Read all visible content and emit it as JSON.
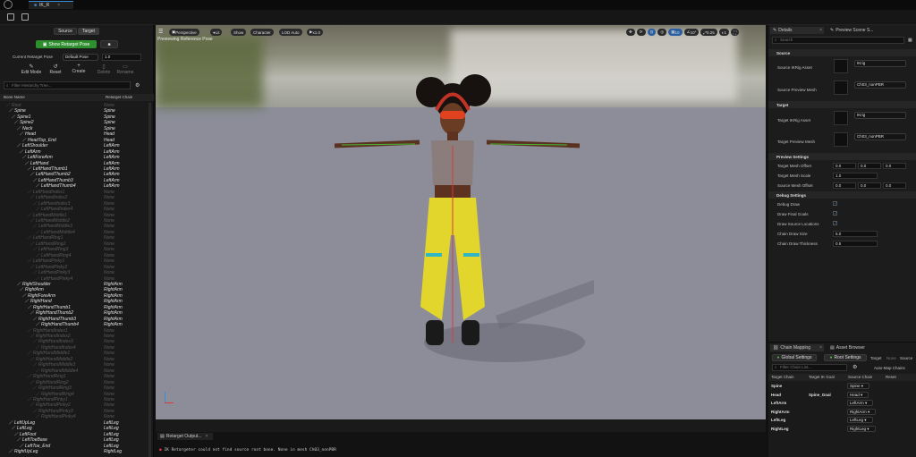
{
  "window": {
    "tab_title": "IK_R"
  },
  "left": {
    "tabs": [
      "Source",
      "Target"
    ],
    "show_pose_button": "Show Retarget Pose",
    "current_pose_label": "Current Retarget Pose",
    "current_pose_value": "Default Pose",
    "pose_blend": "1.0",
    "tools": [
      "Edit Mode",
      "Reset",
      "Create",
      "Delete",
      "Rename"
    ],
    "filter_placeholder": "Filter Hierarchy Tree...",
    "col_bone": "Bone Name",
    "col_chain": "Retarget Chain",
    "bones": [
      {
        "n": "Root",
        "c": "None",
        "d": 1,
        "a": false
      },
      {
        "n": "Spine",
        "c": "Spine",
        "d": 2,
        "a": true
      },
      {
        "n": "Spine1",
        "c": "Spine",
        "d": 3,
        "a": true
      },
      {
        "n": "Spine2",
        "c": "Spine",
        "d": 4,
        "a": true
      },
      {
        "n": "Neck",
        "c": "Spine",
        "d": 5,
        "a": true
      },
      {
        "n": "Head",
        "c": "Head",
        "d": 6,
        "a": true
      },
      {
        "n": "HeadTop_End",
        "c": "Head",
        "d": 7,
        "a": true
      },
      {
        "n": "LeftShoulder",
        "c": "LeftArm",
        "d": 5,
        "a": true
      },
      {
        "n": "LeftArm",
        "c": "LeftArm",
        "d": 6,
        "a": true
      },
      {
        "n": "LeftForeArm",
        "c": "LeftArm",
        "d": 7,
        "a": true
      },
      {
        "n": "LeftHand",
        "c": "LeftArm",
        "d": 8,
        "a": true
      },
      {
        "n": "LeftHandThumb1",
        "c": "LeftArm",
        "d": 9,
        "a": true
      },
      {
        "n": "LeftHandThumb2",
        "c": "LeftArm",
        "d": 10,
        "a": true
      },
      {
        "n": "LeftHandThumb3",
        "c": "LeftArm",
        "d": 11,
        "a": true
      },
      {
        "n": "LeftHandThumb4",
        "c": "LeftArm",
        "d": 12,
        "a": true
      },
      {
        "n": "LeftHandIndex1",
        "c": "None",
        "d": 9,
        "a": false
      },
      {
        "n": "LeftHandIndex2",
        "c": "None",
        "d": 10,
        "a": false
      },
      {
        "n": "LeftHandIndex3",
        "c": "None",
        "d": 11,
        "a": false
      },
      {
        "n": "LeftHandIndex4",
        "c": "None",
        "d": 12,
        "a": false
      },
      {
        "n": "LeftHandMiddle1",
        "c": "None",
        "d": 9,
        "a": false
      },
      {
        "n": "LeftHandMiddle2",
        "c": "None",
        "d": 10,
        "a": false
      },
      {
        "n": "LeftHandMiddle3",
        "c": "None",
        "d": 11,
        "a": false
      },
      {
        "n": "LeftHandMiddle4",
        "c": "None",
        "d": 12,
        "a": false
      },
      {
        "n": "LeftHandRing1",
        "c": "None",
        "d": 9,
        "a": false
      },
      {
        "n": "LeftHandRing2",
        "c": "None",
        "d": 10,
        "a": false
      },
      {
        "n": "LeftHandRing3",
        "c": "None",
        "d": 11,
        "a": false
      },
      {
        "n": "LeftHandRing4",
        "c": "None",
        "d": 12,
        "a": false
      },
      {
        "n": "LeftHandPinky1",
        "c": "None",
        "d": 9,
        "a": false
      },
      {
        "n": "LeftHandPinky2",
        "c": "None",
        "d": 10,
        "a": false
      },
      {
        "n": "LeftHandPinky3",
        "c": "None",
        "d": 11,
        "a": false
      },
      {
        "n": "LeftHandPinky4",
        "c": "None",
        "d": 12,
        "a": false
      },
      {
        "n": "RightShoulder",
        "c": "RightArm",
        "d": 5,
        "a": true
      },
      {
        "n": "RightArm",
        "c": "RightArm",
        "d": 6,
        "a": true
      },
      {
        "n": "RightForeArm",
        "c": "RightArm",
        "d": 7,
        "a": true
      },
      {
        "n": "RightHand",
        "c": "RightArm",
        "d": 8,
        "a": true
      },
      {
        "n": "RightHandThumb1",
        "c": "RightArm",
        "d": 9,
        "a": true
      },
      {
        "n": "RightHandThumb2",
        "c": "RightArm",
        "d": 10,
        "a": true
      },
      {
        "n": "RightHandThumb3",
        "c": "RightArm",
        "d": 11,
        "a": true
      },
      {
        "n": "RightHandThumb4",
        "c": "RightArm",
        "d": 12,
        "a": true
      },
      {
        "n": "RightHandIndex1",
        "c": "None",
        "d": 9,
        "a": false
      },
      {
        "n": "RightHandIndex2",
        "c": "None",
        "d": 10,
        "a": false
      },
      {
        "n": "RightHandIndex3",
        "c": "None",
        "d": 11,
        "a": false
      },
      {
        "n": "RightHandIndex4",
        "c": "None",
        "d": 12,
        "a": false
      },
      {
        "n": "RightHandMiddle1",
        "c": "None",
        "d": 9,
        "a": false
      },
      {
        "n": "RightHandMiddle2",
        "c": "None",
        "d": 10,
        "a": false
      },
      {
        "n": "RightHandMiddle3",
        "c": "None",
        "d": 11,
        "a": false
      },
      {
        "n": "RightHandMiddle4",
        "c": "None",
        "d": 12,
        "a": false
      },
      {
        "n": "RightHandRing1",
        "c": "None",
        "d": 9,
        "a": false
      },
      {
        "n": "RightHandRing2",
        "c": "None",
        "d": 10,
        "a": false
      },
      {
        "n": "RightHandRing3",
        "c": "None",
        "d": 11,
        "a": false
      },
      {
        "n": "RightHandRing4",
        "c": "None",
        "d": 12,
        "a": false
      },
      {
        "n": "RightHandPinky1",
        "c": "None",
        "d": 9,
        "a": false
      },
      {
        "n": "RightHandPinky2",
        "c": "None",
        "d": 10,
        "a": false
      },
      {
        "n": "RightHandPinky3",
        "c": "None",
        "d": 11,
        "a": false
      },
      {
        "n": "RightHandPinky4",
        "c": "None",
        "d": 12,
        "a": false
      },
      {
        "n": "LeftUpLeg",
        "c": "LeftLeg",
        "d": 2,
        "a": true
      },
      {
        "n": "LeftLeg",
        "c": "LeftLeg",
        "d": 3,
        "a": true
      },
      {
        "n": "LeftFoot",
        "c": "LeftLeg",
        "d": 4,
        "a": true
      },
      {
        "n": "LeftToeBase",
        "c": "LeftLeg",
        "d": 5,
        "a": true
      },
      {
        "n": "LeftToe_End",
        "c": "LeftLeg",
        "d": 6,
        "a": true
      },
      {
        "n": "RightUpLeg",
        "c": "RightLeg",
        "d": 2,
        "a": true
      }
    ]
  },
  "viewport": {
    "perspective": "Perspective",
    "lit": "Lit",
    "show": "Show",
    "character": "Character",
    "lod": "LOD Auto",
    "speed": "x1.0",
    "overlay_text": "Previewing Reference Pose",
    "grid_snap": "10",
    "angle_snap": "10°",
    "scale_snap": "0.25",
    "cam_speed": "1",
    "output_tab": "Retarget Output...",
    "log_line": "IK Retargeter could not find source root bone. None in mesh Ch03_nonPBR"
  },
  "details": {
    "tab1": "Details",
    "tab2": "Preview Scene S...",
    "search_placeholder": "Search",
    "source_header": "Source",
    "source_rig_label": "Source IKRig Asset",
    "source_rig_value": "IKrig",
    "source_mesh_label": "Source Preview Mesh",
    "source_mesh_value": "Ch03_nonPBR",
    "target_header": "Target",
    "target_rig_label": "Target IKRig Asset",
    "target_rig_value": "IKrig",
    "target_mesh_label": "Target Preview Mesh",
    "target_mesh_value": "Ch03_nonPBR",
    "preview_header": "Preview Settings",
    "tm_offset_label": "Target Mesh Offset",
    "tm_offset": [
      "0.0",
      "0.0",
      "0.0"
    ],
    "tm_scale_label": "Target Mesh Scale",
    "tm_scale": "1.0",
    "sm_offset_label": "Source Mesh Offset",
    "sm_offset": [
      "0.0",
      "0.0",
      "0.0"
    ],
    "debug_header": "Debug Settings",
    "debug_draw_label": "Debug Draw",
    "final_goals_label": "Draw Final Goals",
    "source_locations_label": "Draw Source Locations",
    "chain_size_label": "Chain Draw Size",
    "chain_size": "5.0",
    "chain_thick_label": "Chain Draw Thickness",
    "chain_thick": "0.5"
  },
  "chain_mapping": {
    "tab1": "Chain Mapping",
    "tab2": "Asset Browser",
    "global_btn": "Global Settings",
    "root_btn": "Root Settings",
    "target_link": "Target",
    "none_link": "None",
    "source_link": "Source",
    "filter_placeholder": "Filter Chain List...",
    "auto_map": "Auto-Map Chains",
    "cols": [
      "Target Chain",
      "Target IK Goal",
      "Source Chain",
      "Reset"
    ],
    "rows": [
      {
        "t": "Spine",
        "g": "",
        "s": "Spine"
      },
      {
        "t": "Head",
        "g": "Spine_Goal",
        "s": "Head"
      },
      {
        "t": "LeftArm",
        "g": "",
        "s": "LeftArm"
      },
      {
        "t": "RightArm",
        "g": "",
        "s": "RightArm"
      },
      {
        "t": "LeftLeg",
        "g": "",
        "s": "LeftLeg"
      },
      {
        "t": "RightLeg",
        "g": "",
        "s": "RightLeg"
      }
    ]
  }
}
